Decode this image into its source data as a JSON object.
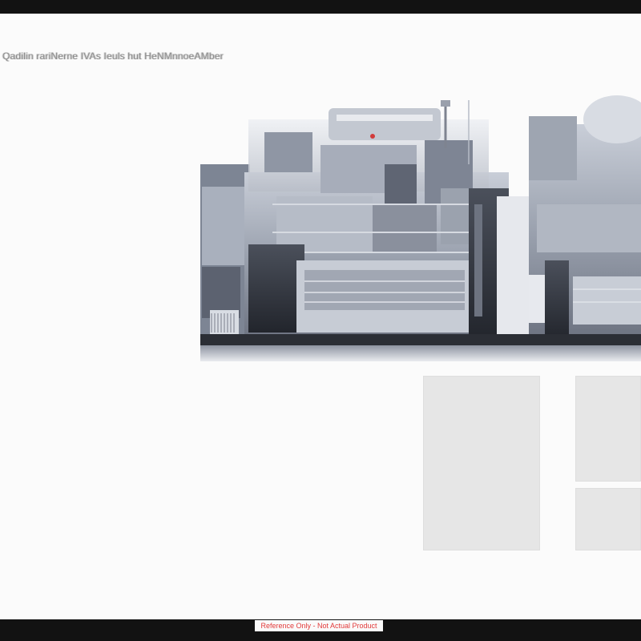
{
  "header": {
    "garbled_caption": "Qadilin rariNerne IVAs Ieuls hut HeNMnnoeAMber"
  },
  "image": {
    "icon": "industrial-machinery-illustration"
  },
  "panels": {
    "count": 3
  },
  "footer": {
    "notice": "Reference Only - Not Actual Product"
  },
  "colors": {
    "frame": "#121212",
    "canvas": "#fbfbfb",
    "panel": "#e6e6e6",
    "notice_text": "#e23a3a"
  }
}
